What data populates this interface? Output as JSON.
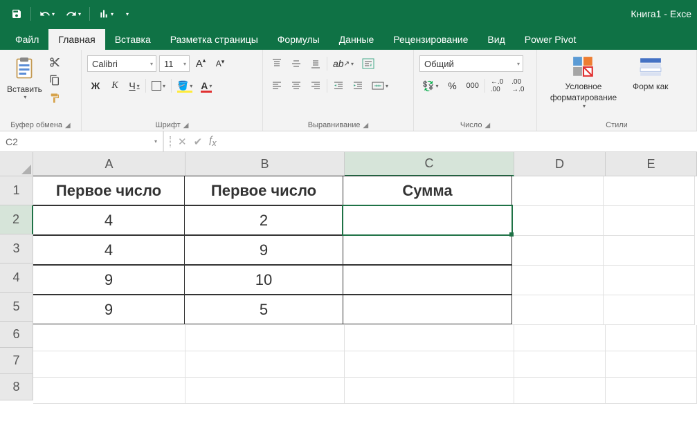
{
  "app": {
    "title": "Книга1 - Exce"
  },
  "qat": {
    "items": [
      "save-icon",
      "undo-icon",
      "redo-icon",
      "chart-icon"
    ]
  },
  "tabs": {
    "file": "Файл",
    "home": "Главная",
    "insert": "Вставка",
    "pagelayout": "Разметка страницы",
    "formulas": "Формулы",
    "data": "Данные",
    "review": "Рецензирование",
    "view": "Вид",
    "powerpivot": "Power Pivot"
  },
  "ribbon": {
    "clipboard": {
      "paste": "Вставить",
      "label": "Буфер обмена"
    },
    "font": {
      "name": "Calibri",
      "size": "11",
      "label": "Шрифт",
      "bold": "Ж",
      "italic": "К",
      "underline": "Ч"
    },
    "align": {
      "label": "Выравнивание"
    },
    "number": {
      "format": "Общий",
      "label": "Число"
    },
    "styles": {
      "conditional": "Условное форматирование",
      "formatas": "Форм как",
      "label": "Стили"
    }
  },
  "formula": {
    "cellref": "C2",
    "value": ""
  },
  "sheet": {
    "cols": [
      "A",
      "B",
      "C",
      "D",
      "E"
    ],
    "rows": [
      "1",
      "2",
      "3",
      "4",
      "5",
      "6",
      "7",
      "8"
    ],
    "selectedCell": "C2",
    "headers": {
      "A": "Первое число",
      "B": "Первое число",
      "C": "Сумма"
    },
    "data": [
      {
        "A": "4",
        "B": "2",
        "C": ""
      },
      {
        "A": "4",
        "B": "9",
        "C": ""
      },
      {
        "A": "9",
        "B": "10",
        "C": ""
      },
      {
        "A": "9",
        "B": "5",
        "C": ""
      }
    ]
  }
}
